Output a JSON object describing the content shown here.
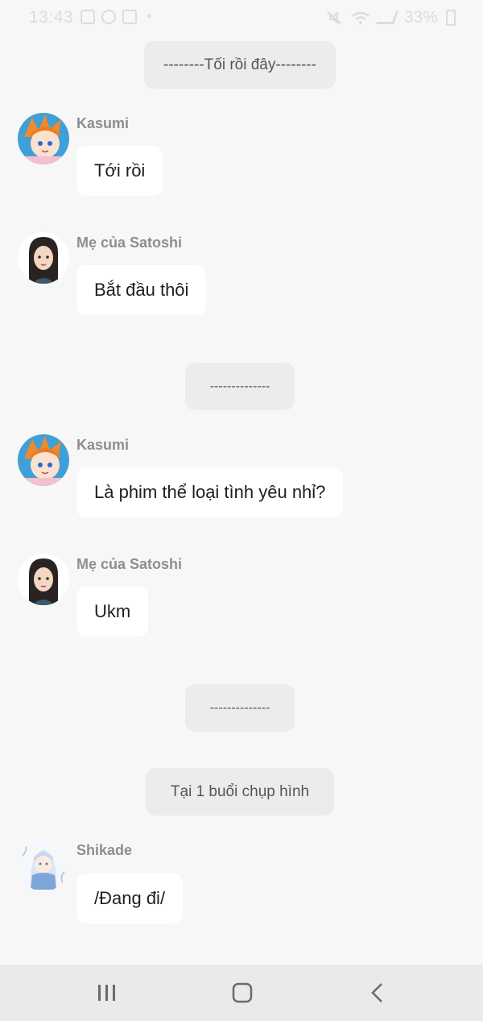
{
  "status_bar": {
    "time": "13:43",
    "battery_text": "33%"
  },
  "chat": {
    "pill_top": "--------Tối rồi đây--------",
    "divider_1": "--------------",
    "divider_2": "--------------",
    "pill_scene": "Tại 1 buổi chụp hình",
    "messages": [
      {
        "sender": "Kasumi",
        "text": "Tới rồi",
        "avatar": "kasumi-avatar"
      },
      {
        "sender": "Mẹ của Satoshi",
        "text": "Bắt đầu thôi",
        "avatar": "satoshi-mom-avatar"
      },
      {
        "sender": "Kasumi",
        "text": "Là phim thể loại tình yêu nhỉ?",
        "avatar": "kasumi-avatar"
      },
      {
        "sender": "Mẹ của Satoshi",
        "text": "Ukm",
        "avatar": "satoshi-mom-avatar"
      },
      {
        "sender": "Shikade",
        "text": "/Đang đi/",
        "avatar": "shikade-avatar"
      }
    ]
  },
  "nav_bar": {
    "icons": [
      "recent-apps-icon",
      "home-icon",
      "back-icon"
    ]
  },
  "colors": {
    "background": "#f7f7f7",
    "bubble": "#ffffff",
    "pill": "#ececec",
    "sender": "#8e8e8e"
  }
}
